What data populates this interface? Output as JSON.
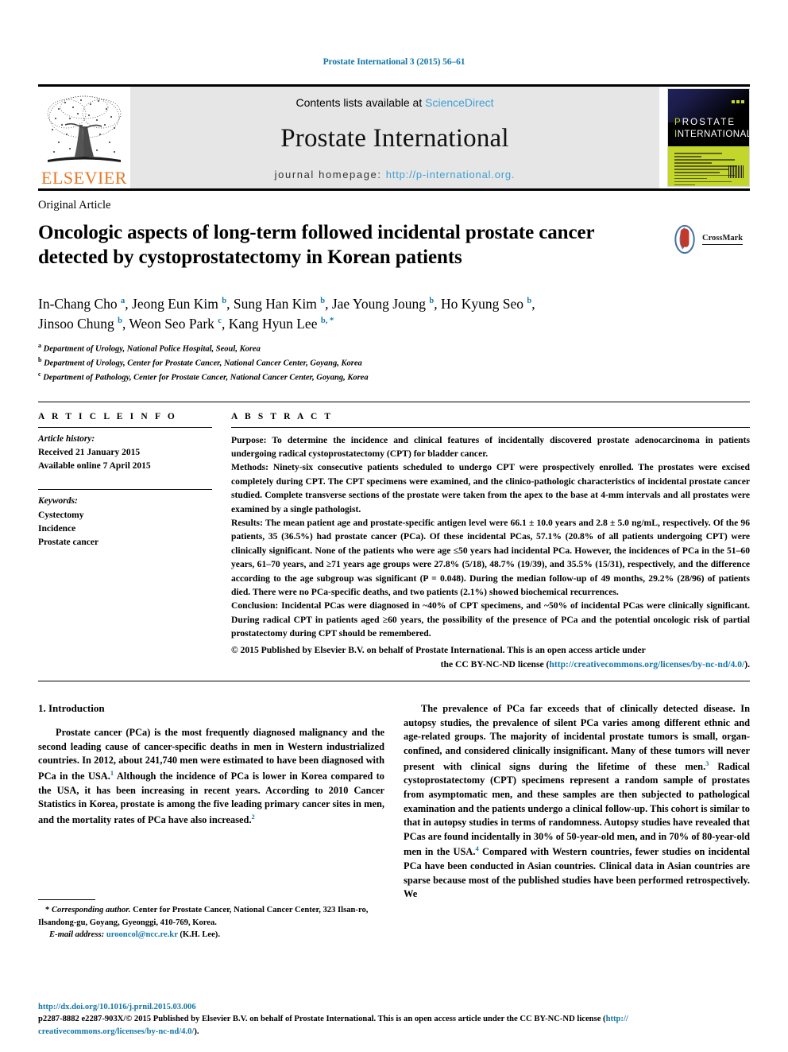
{
  "running_head": "Prostate International 3 (2015) 56–61",
  "masthead": {
    "contents_prefix": "Contents lists available at ",
    "sciencedirect": "ScienceDirect",
    "journal_name": "Prostate International",
    "homepage_label": "journal homepage: ",
    "homepage_url": "http://p-international.org.",
    "elsevier_wordmark": "ELSEVIER",
    "cover": {
      "title_line1": "PROSTATE",
      "title_line2": "INTERNATIONAL"
    }
  },
  "article": {
    "kind": "Original Article",
    "title": "Oncologic aspects of long-term followed incidental prostate cancer detected by cystoprostatectomy in Korean patients",
    "crossmark_label": "CrossMark",
    "authors_line1": "In-Chang Cho <sup>a</sup>, Jeong Eun Kim <sup>b</sup>, Sung Han Kim <sup>b</sup>, Jae Young Joung <sup>b</sup>, Ho Kyung Seo <sup>b</sup>,",
    "authors_line2": "Jinsoo Chung <sup>b</sup>, Weon Seo Park <sup>c</sup>, Kang Hyun Lee <sup>b, *</sup>",
    "affiliations": [
      "<sup>a</sup> Department of Urology, National Police Hospital, Seoul, Korea",
      "<sup>b</sup> Department of Urology, Center for Prostate Cancer, National Cancer Center, Goyang, Korea",
      "<sup>c</sup> Department of Pathology, Center for Prostate Cancer, National Cancer Center, Goyang, Korea"
    ]
  },
  "article_info": {
    "heading": "A R T I C L E  I N F O",
    "history_label": "Article history:",
    "received": "Received 21 January 2015",
    "available_online": "Available online 7 April 2015",
    "keywords_label": "Keywords:",
    "keywords": [
      "Cystectomy",
      "Incidence",
      "Prostate cancer"
    ]
  },
  "abstract": {
    "heading": "A B S T R A C T",
    "purpose_label": "Purpose:",
    "purpose": " To determine the incidence and clinical features of incidentally discovered prostate adenocarcinoma in patients undergoing radical cystoprostatectomy (CPT) for bladder cancer.",
    "methods_label": "Methods:",
    "methods": " Ninety-six consecutive patients scheduled to undergo CPT were prospectively enrolled. The prostates were excised completely during CPT. The CPT specimens were examined, and the clinico-pathologic characteristics of incidental prostate cancer studied. Complete transverse sections of the prostate were taken from the apex to the base at 4-mm intervals and all prostates were examined by a single pathologist.",
    "results_label": "Results:",
    "results": " The mean patient age and prostate-specific antigen level were 66.1 ± 10.0 years and 2.8 ± 5.0 ng/mL, respectively. Of the 96 patients, 35 (36.5%) had prostate cancer (PCa). Of these incidental PCas, 57.1% (20.8% of all patients undergoing CPT) were clinically significant. None of the patients who were age ≤50 years had incidental PCa. However, the incidences of PCa in the 51–60 years, 61–70 years, and ≥71 years age groups were 27.8% (5/18), 48.7% (19/39), and 35.5% (15/31), respectively, and the difference according to the age subgroup was significant (P = 0.048). During the median follow-up of 49 months, 29.2% (28/96) of patients died. There were no PCa-specific deaths, and two patients (2.1%) showed biochemical recurrences.",
    "conclusion_label": "Conclusion:",
    "conclusion": " Incidental PCas were diagnosed in ~40% of CPT specimens, and ~50% of incidental PCas were clinically significant. During radical CPT in patients aged ≥60 years, the possibility of the presence of PCa and the potential oncologic risk of partial prostatectomy during CPT should be remembered.",
    "copyright_line": "© 2015 Published by Elsevier B.V. on behalf of Prostate International. This is an open access article under",
    "license_prefix": "the CC BY-NC-ND license (",
    "license_url": "http://creativecommons.org/licenses/by-nc-nd/4.0/",
    "license_suffix": ")."
  },
  "introduction": {
    "heading": "1. Introduction",
    "para_left": "Prostate cancer (PCa) is the most frequently diagnosed malignancy and the second leading cause of cancer-specific deaths in men in Western industrialized countries. In 2012, about 241,740 men were estimated to have been diagnosed with PCa in the USA.<sup>1</sup> Although the incidence of PCa is lower in Korea compared to the USA, it has been increasing in recent years. According to 2010 Cancer Statistics in Korea, prostate is among the five leading primary cancer sites in men, and the mortality rates of PCa have also increased.<sup>2</sup>",
    "para_right": "The prevalence of PCa far exceeds that of clinically detected disease. In autopsy studies, the prevalence of silent PCa varies among different ethnic and age-related groups. The majority of incidental prostate tumors is small, organ-confined, and considered clinically insignificant. Many of these tumors will never present with clinical signs during the lifetime of these men.<sup>3</sup> Radical cystoprostatectomy (CPT) specimens represent a random sample of prostates from asymptomatic men, and these samples are then subjected to pathological examination and the patients undergo a clinical follow-up. This cohort is similar to that in autopsy studies in terms of randomness. Autopsy studies have revealed that PCas are found incidentally in 30% of 50-year-old men, and in 70% of 80-year-old men in the USA.<sup>4</sup> Compared with Western countries, fewer studies on incidental PCa have been conducted in Asian countries. Clinical data in Asian countries are sparse because most of the published studies have been performed retrospectively. We"
  },
  "footnote": {
    "corresponding_marker": "*",
    "corresponding_label": "Corresponding author.",
    "corresponding_text": " Center for Prostate Cancer, National Cancer Center, 323 Ilsan-ro, Ilsandong-gu, Goyang, Gyeonggi, 410-769, Korea.",
    "email_label": "E-mail address:",
    "email": "urooncol@ncc.re.kr",
    "email_owner": " (K.H. Lee)."
  },
  "page_footer": {
    "doi": "http://dx.doi.org/10.1016/j.prnil.2015.03.006",
    "issn_line": "p2287-8882 e2287-903X/© 2015 Published by Elsevier B.V. on behalf of Prostate International. This is an open access article under the CC BY-NC-ND license (",
    "license_url_part1": "http://",
    "license_url_part2": "creativecommons.org/licenses/by-nc-nd/4.0/",
    "license_suffix": ")."
  },
  "colors": {
    "link": "#1277a8",
    "sciencedirect": "#3c9fd4",
    "elsevier_orange": "#E77724",
    "cover_green": "#c3d62b"
  }
}
